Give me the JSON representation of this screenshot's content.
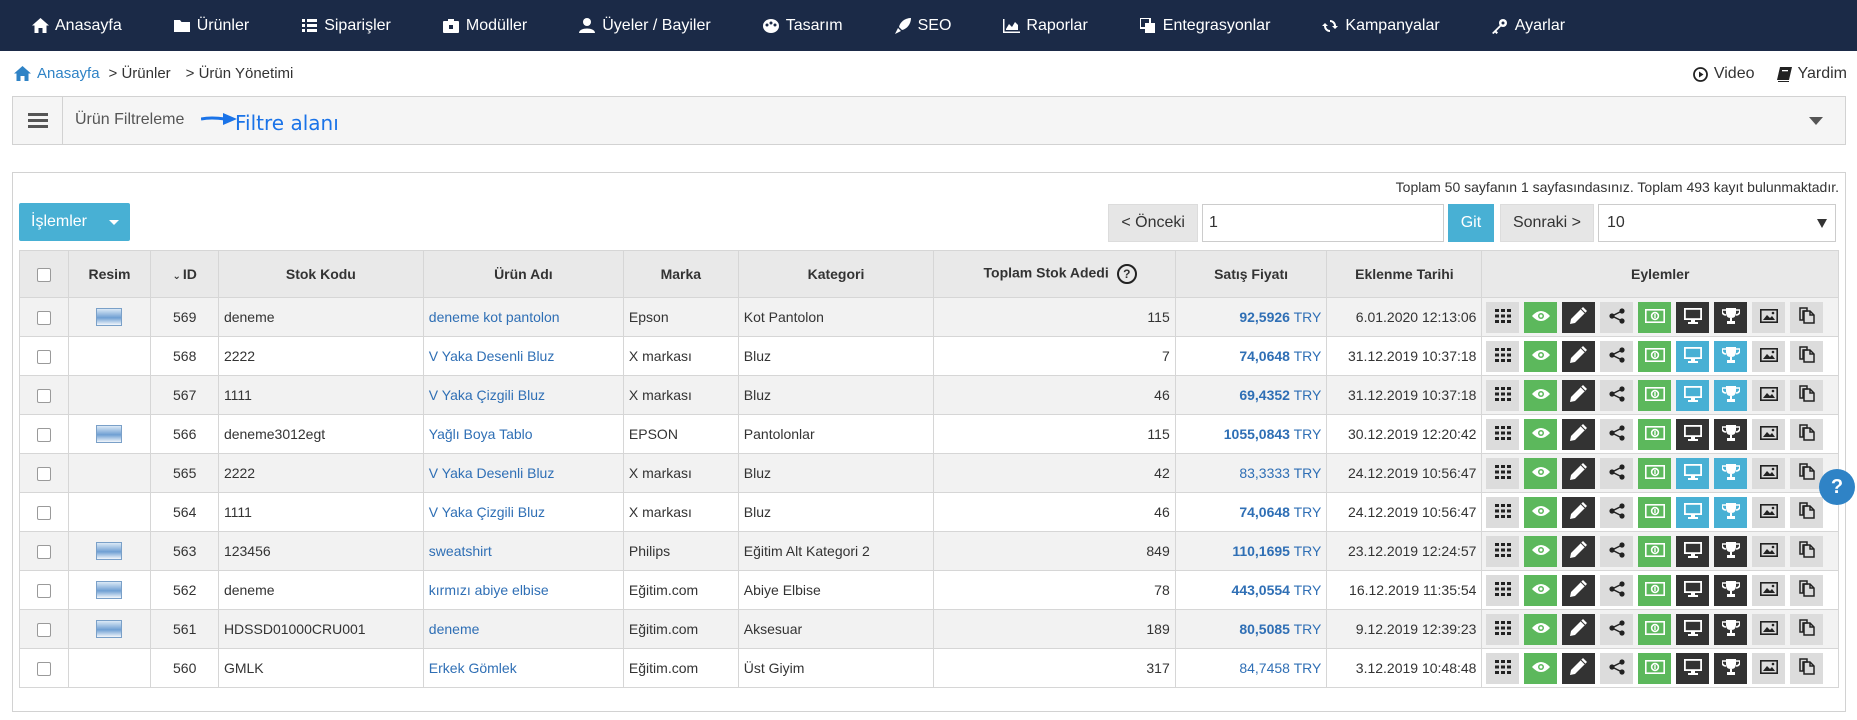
{
  "nav": [
    {
      "label": "Anasayfa",
      "icon": "home-icon"
    },
    {
      "label": "Ürünler",
      "icon": "folder-icon"
    },
    {
      "label": "Siparişler",
      "icon": "list-icon"
    },
    {
      "label": "Modüller",
      "icon": "module-icon"
    },
    {
      "label": "Üyeler / Bayiler",
      "icon": "users-icon"
    },
    {
      "label": "Tasarım",
      "icon": "palette-icon"
    },
    {
      "label": "SEO",
      "icon": "rocket-icon"
    },
    {
      "label": "Raporlar",
      "icon": "chart-icon"
    },
    {
      "label": "Entegrasyonlar",
      "icon": "copy-icon"
    },
    {
      "label": "Kampanyalar",
      "icon": "refresh-icon"
    },
    {
      "label": "Ayarlar",
      "icon": "key-icon"
    }
  ],
  "breadcrumb": {
    "home": "Anasayfa",
    "level1": "> Ürünler",
    "level2": "> Ürün Yönetimi"
  },
  "toplinks": {
    "video": "Video",
    "help": "Yardim"
  },
  "filter": {
    "title": "Ürün Filtreleme",
    "annotation": "Filtre alanı"
  },
  "listing": {
    "info": "Toplam 50 sayfanın 1 sayfasındasınız. Toplam 493 kayıt bulunmaktadır.",
    "actions_button": "İşlemler",
    "prev": "< Önceki",
    "page_value": "1",
    "go": "Git",
    "next": "Sonraki >",
    "per_page": "10"
  },
  "columns": {
    "image": "Resim",
    "id": "ID",
    "sku": "Stok Kodu",
    "name": "Ürün Adı",
    "brand": "Marka",
    "category": "Kategori",
    "stock": "Toplam Stok Adedi",
    "price": "Satış Fiyatı",
    "date": "Eklenme Tarihi",
    "actions": "Eylemler"
  },
  "rows": [
    {
      "img": true,
      "id": "569",
      "sku": "deneme",
      "name": "deneme kot pantolon",
      "brand": "Epson",
      "category": "Kot Pantolon",
      "stock": "115",
      "price": "92,5926",
      "currency": "TRY",
      "bold": true,
      "date": "6.01.2020 12:13:06",
      "monitor": "dark"
    },
    {
      "img": false,
      "id": "568",
      "sku": "2222",
      "name": "V Yaka Desenli Bluz",
      "brand": "X markası",
      "category": "Bluz",
      "stock": "7",
      "price": "74,0648",
      "currency": "TRY",
      "bold": true,
      "date": "31.12.2019 10:37:18",
      "monitor": "blue"
    },
    {
      "img": false,
      "id": "567",
      "sku": "1111",
      "name": "V Yaka Çizgili Bluz",
      "brand": "X markası",
      "category": "Bluz",
      "stock": "46",
      "price": "69,4352",
      "currency": "TRY",
      "bold": true,
      "date": "31.12.2019 10:37:18",
      "monitor": "blue"
    },
    {
      "img": true,
      "id": "566",
      "sku": "deneme3012egt",
      "name": "Yağlı Boya Tablo",
      "brand": "EPSON",
      "category": "Pantolonlar",
      "stock": "115",
      "price": "1055,0843",
      "currency": "TRY",
      "bold": true,
      "date": "30.12.2019 12:20:42",
      "monitor": "dark"
    },
    {
      "img": false,
      "id": "565",
      "sku": "2222",
      "name": "V Yaka Desenli Bluz",
      "brand": "X markası",
      "category": "Bluz",
      "stock": "42",
      "price": "83,3333",
      "currency": "TRY",
      "bold": false,
      "date": "24.12.2019 10:56:47",
      "monitor": "blue"
    },
    {
      "img": false,
      "id": "564",
      "sku": "1111",
      "name": "V Yaka Çizgili Bluz",
      "brand": "X markası",
      "category": "Bluz",
      "stock": "46",
      "price": "74,0648",
      "currency": "TRY",
      "bold": true,
      "date": "24.12.2019 10:56:47",
      "monitor": "blue"
    },
    {
      "img": true,
      "id": "563",
      "sku": "123456",
      "name": "sweatshirt",
      "brand": "Philips",
      "category": "Eğitim Alt Kategori 2",
      "stock": "849",
      "price": "110,1695",
      "currency": "TRY",
      "bold": true,
      "date": "23.12.2019 12:24:57",
      "monitor": "dark"
    },
    {
      "img": true,
      "id": "562",
      "sku": "deneme",
      "name": "kırmızı abiye elbise",
      "brand": "Eğitim.com",
      "category": "Abiye Elbise",
      "stock": "78",
      "price": "443,0554",
      "currency": "TRY",
      "bold": true,
      "date": "16.12.2019 11:35:54",
      "monitor": "dark"
    },
    {
      "img": true,
      "id": "561",
      "sku": "HDSSD01000CRU001",
      "name": "deneme",
      "brand": "Eğitim.com",
      "category": "Aksesuar",
      "stock": "189",
      "price": "80,5085",
      "currency": "TRY",
      "bold": true,
      "date": "9.12.2019 12:39:23",
      "monitor": "dark"
    },
    {
      "img": false,
      "id": "560",
      "sku": "GMLK",
      "name": "Erkek Gömlek",
      "brand": "Eğitim.com",
      "category": "Üst Giyim",
      "stock": "317",
      "price": "84,7458",
      "currency": "TRY",
      "bold": false,
      "date": "3.12.2019 10:48:48",
      "monitor": "dark"
    }
  ],
  "colors": {
    "nav_bg": "#1b2a47",
    "accent": "#48b0d4",
    "green": "#5cb85c",
    "dark": "#333333",
    "link": "#2f6fb5"
  }
}
